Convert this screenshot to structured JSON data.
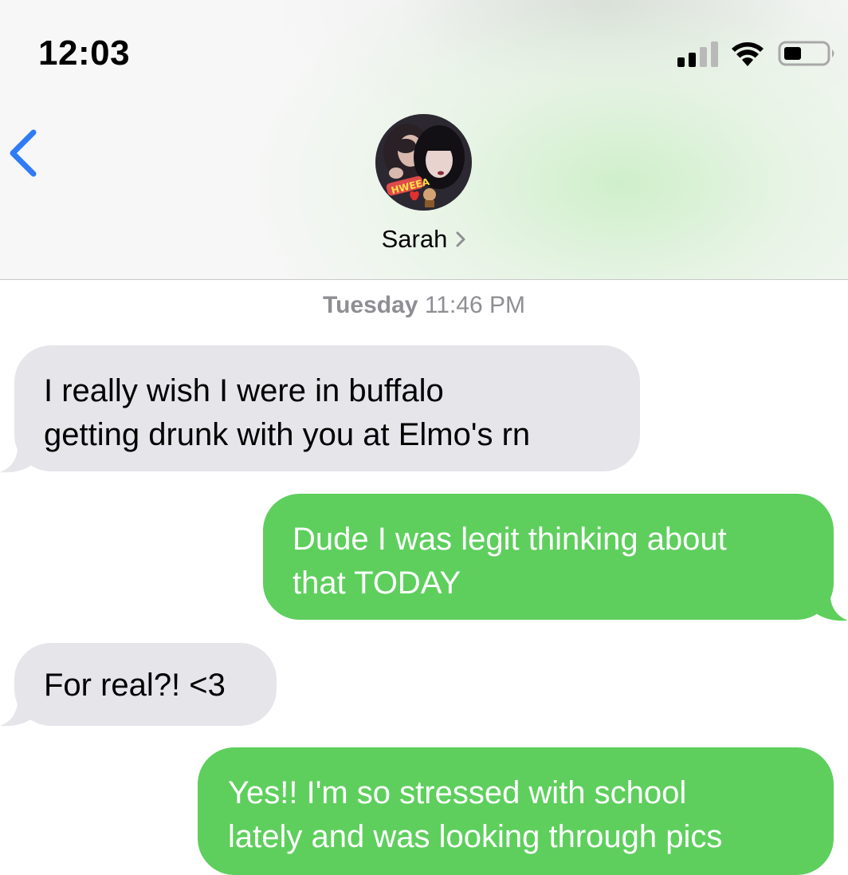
{
  "status_bar": {
    "time": "12:03",
    "signal_bars": 2,
    "signal_total": 4
  },
  "header": {
    "contact_name": "Sarah",
    "avatar": "contact-photo"
  },
  "conversation": {
    "timestamp_day": "Tuesday",
    "timestamp_time": "11:46 PM",
    "messages": [
      {
        "direction": "incoming",
        "text": "I really wish I were in buffalo\ngetting drunk with you at Elmo's rn"
      },
      {
        "direction": "outgoing",
        "text": "Dude I was legit thinking about\nthat TODAY"
      },
      {
        "direction": "incoming",
        "text": "For real?! <3"
      },
      {
        "direction": "outgoing",
        "text": "Yes!! I'm so stressed with school\nlately and was looking through pics"
      }
    ]
  },
  "colors": {
    "incoming_bubble": "#e5e5ea",
    "outgoing_bubble": "#5ecf5d",
    "accent_blue": "#2f7cf6",
    "timestamp_gray": "#8e8e93"
  },
  "icons": {
    "back": "chevron-left-icon",
    "contact_details": "chevron-right-icon",
    "signal": "cellular-signal-icon",
    "wifi": "wifi-icon",
    "battery": "battery-icon"
  }
}
